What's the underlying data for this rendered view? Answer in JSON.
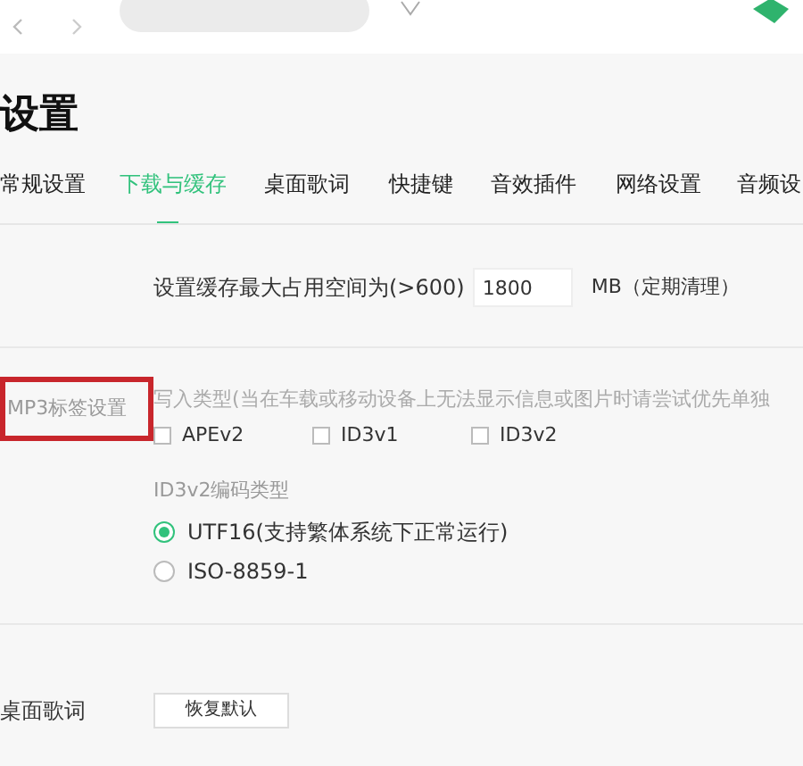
{
  "page_title": "设置",
  "tabs": [
    {
      "label": "常规设置",
      "selected": false
    },
    {
      "label": "下载与缓存",
      "selected": true
    },
    {
      "label": "桌面歌词",
      "selected": false
    },
    {
      "label": "快捷键",
      "selected": false
    },
    {
      "label": "音效插件",
      "selected": false
    },
    {
      "label": "网络设置",
      "selected": false
    },
    {
      "label": "音频设",
      "selected": false
    }
  ],
  "cache": {
    "label": "设置缓存最大占用空间为(>600)",
    "value": "1800",
    "unit": "MB（定期清理）"
  },
  "mp3_tags": {
    "label": "MP3标签设置",
    "highlighted": true,
    "hint": "写入类型(当在车载或移动设备上无法显示信息或图片时请尝试优先单独",
    "checkboxes": [
      {
        "label": "APEv2",
        "checked": false
      },
      {
        "label": "ID3v1",
        "checked": false
      },
      {
        "label": "ID3v2",
        "checked": false
      }
    ],
    "encoding_label": "ID3v2编码类型",
    "encodings": [
      {
        "label": "UTF16(支持繁体系统下正常运行)",
        "selected": true
      },
      {
        "label": "ISO-8859-1",
        "selected": false
      }
    ]
  },
  "lyrics": {
    "label": "桌面歌词",
    "button": "恢复默认"
  }
}
